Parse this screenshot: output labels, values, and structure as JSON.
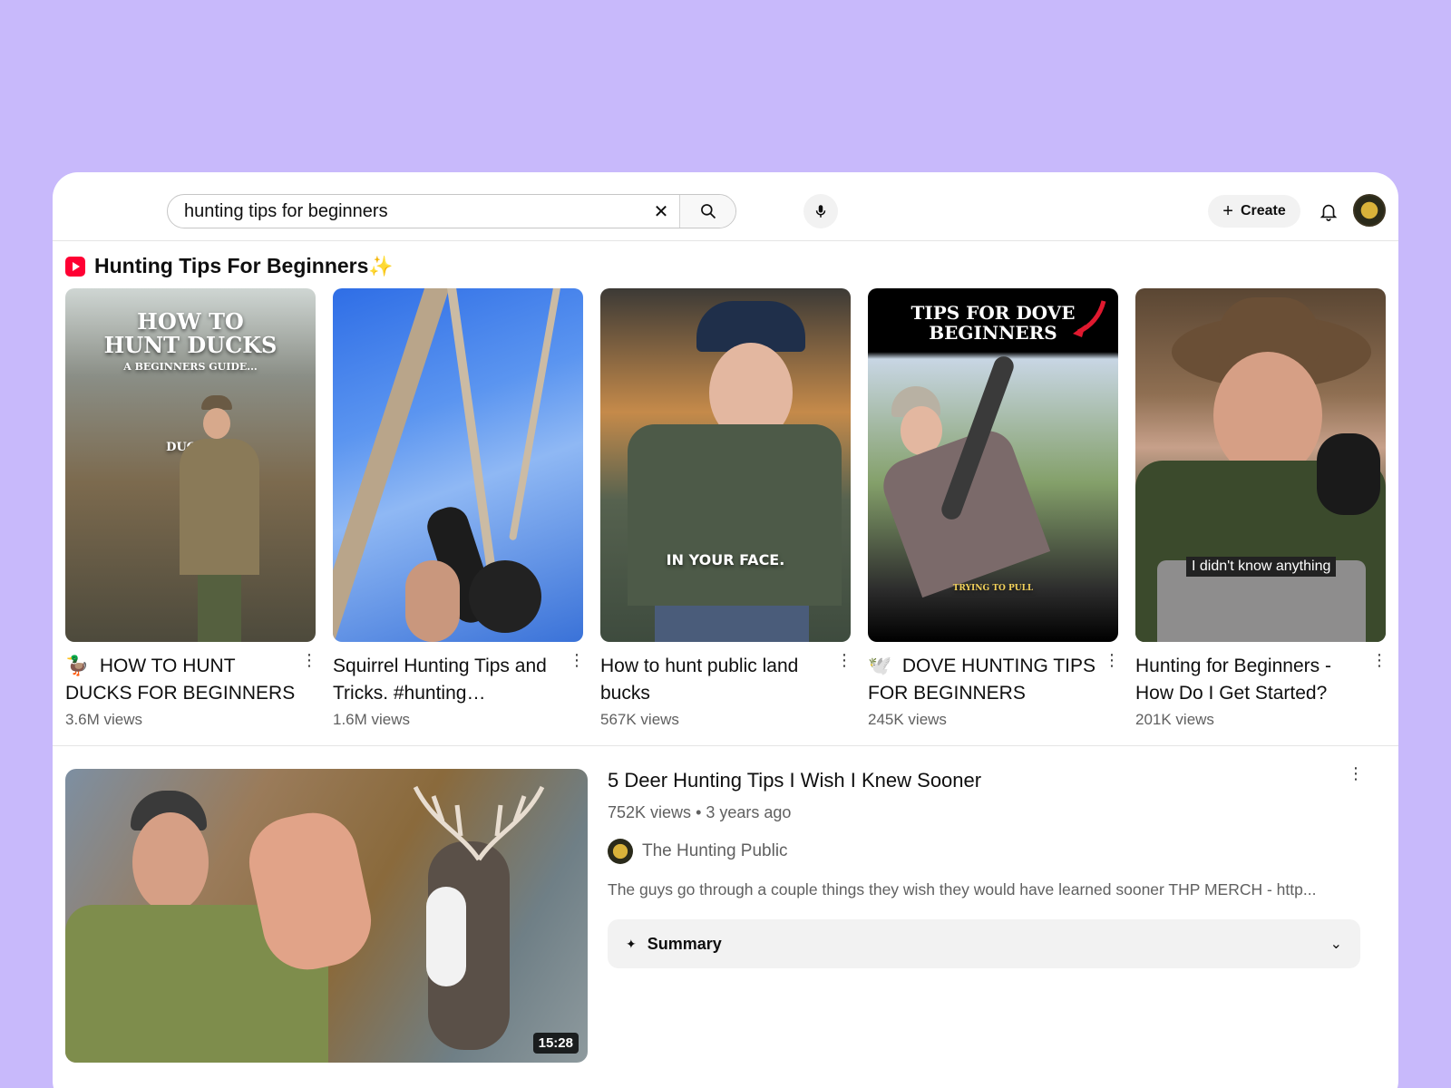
{
  "search": {
    "query": "hunting tips for beginners",
    "clear_icon": "close-icon",
    "search_icon": "search-icon",
    "mic_icon": "mic-icon"
  },
  "header": {
    "create_label": "Create",
    "bell_icon": "bell-icon"
  },
  "shorts_shelf": {
    "title": "Hunting Tips For Beginners",
    "title_emoji": "✨",
    "items": [
      {
        "emoji": "🦆",
        "title": "HOW TO HUNT DUCKS FOR BEGINNERS",
        "views": "3.6M views",
        "overlay": "HOW TO HUNT DUCKS",
        "overlay_sub": "A BEGINNERS GUIDE...",
        "overlay_tag": "DUCKS"
      },
      {
        "emoji": "",
        "title": "Squirrel Hunting Tips and Tricks. #hunting…",
        "views": "1.6M views"
      },
      {
        "emoji": "",
        "title": "How to hunt public land bucks",
        "views": "567K views",
        "overlay": "IN YOUR FACE."
      },
      {
        "emoji": "🕊️",
        "title": "DOVE HUNTING TIPS FOR BEGINNERS",
        "views": "245K views",
        "overlay": "TIPS FOR DOVE BEGINNERS",
        "overlay_sub": "TRYING TO PULL"
      },
      {
        "emoji": "",
        "title": "Hunting for Beginners - How Do I Get Started?",
        "views": "201K views",
        "overlay": "I didn't know anything"
      }
    ]
  },
  "video": {
    "title": "5 Deer Hunting Tips I Wish I Knew Sooner",
    "views": "752K views",
    "age": "3 years ago",
    "channel": "The Hunting Public",
    "description": "The guys go through a couple things they wish they would have learned sooner THP MERCH - http...",
    "duration": "15:28",
    "summary_label": "Summary"
  },
  "colors": {
    "background": "#c8b9fb",
    "shorts_red": "#ff0033",
    "meta_gray": "#606060"
  }
}
